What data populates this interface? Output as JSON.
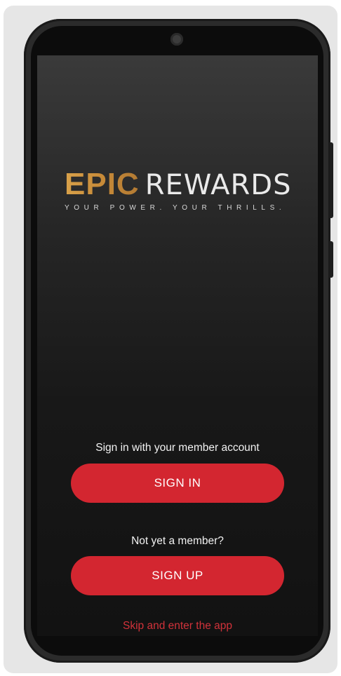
{
  "app": {
    "brand_primary": "EPIC",
    "brand_secondary": "REWARDS",
    "tagline": "YOUR POWER. YOUR THRILLS.",
    "brand_gold": "#c78a38",
    "accent_red": "#d32630"
  },
  "auth": {
    "signin_caption": "Sign in with your member account",
    "signin_label": "SIGN IN",
    "signup_caption": "Not yet a member?",
    "signup_label": "SIGN UP",
    "skip_label": "Skip and enter the app"
  },
  "icons": {
    "camera": "front-camera-icon"
  }
}
